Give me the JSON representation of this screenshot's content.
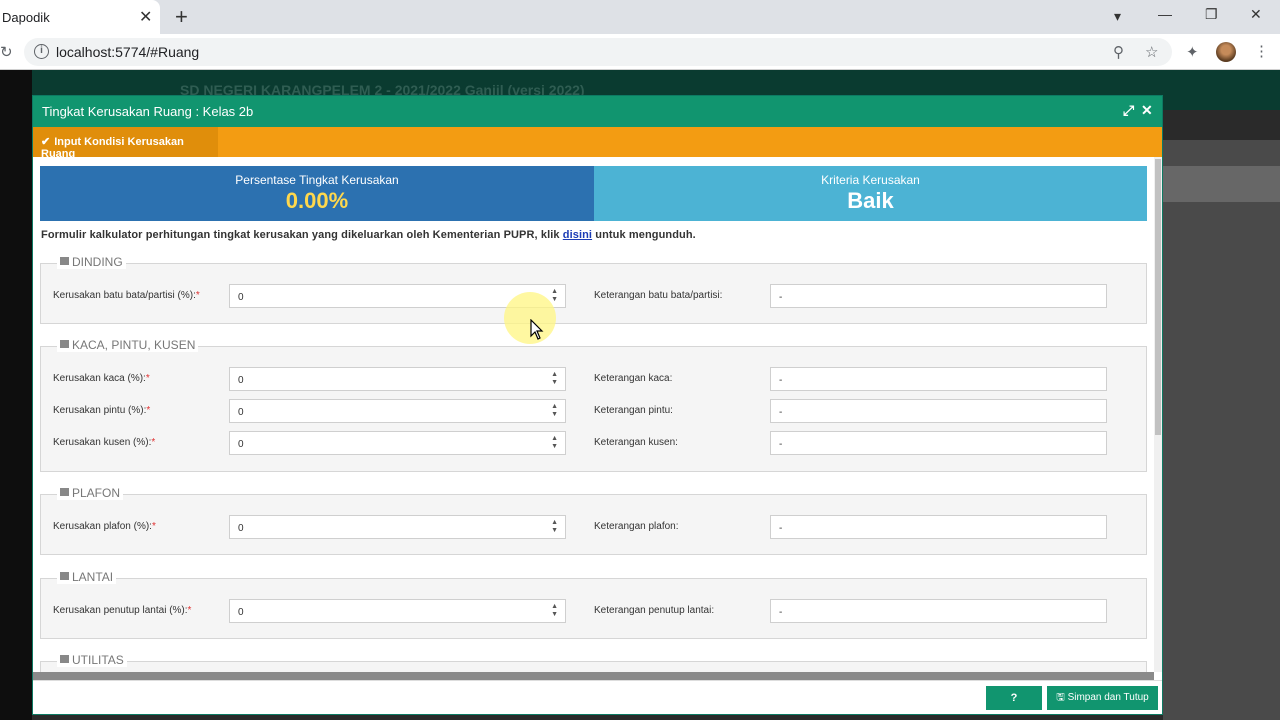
{
  "browser": {
    "tab_title": "Dapodik",
    "url": "localhost:5774/#Ruang"
  },
  "background_app": {
    "title": "SD NEGERI KARANGPELEM 2 - 2021/2022 Ganjil (versi 2022)"
  },
  "modal": {
    "title": "Tingkat Kerusakan Ruang : Kelas 2b",
    "tab_label": "Input Kondisi Kerusakan Ruang",
    "stats": {
      "left_label": "Persentase Tingkat Kerusakan",
      "left_value": "0.00%",
      "right_label": "Kriteria Kerusakan",
      "right_value": "Baik"
    },
    "formula": {
      "prefix": "Formulir kalkulator perhitungan tingkat kerusakan yang dikeluarkan oleh Kementerian PUPR, klik",
      "link": "disini",
      "suffix": "untuk mengunduh."
    },
    "sections": [
      {
        "legend": "DINDING",
        "rows": [
          {
            "label": "Kerusakan batu bata/partisi (%):",
            "value": "0",
            "note_label": "Keterangan batu bata/partisi:",
            "note_value": "-"
          }
        ]
      },
      {
        "legend": "KACA, PINTU, KUSEN",
        "rows": [
          {
            "label": "Kerusakan kaca (%):",
            "value": "0",
            "note_label": "Keterangan kaca:",
            "note_value": "-"
          },
          {
            "label": "Kerusakan pintu (%):",
            "value": "0",
            "note_label": "Keterangan pintu:",
            "note_value": "-"
          },
          {
            "label": "Kerusakan kusen (%):",
            "value": "0",
            "note_label": "Keterangan kusen:",
            "note_value": "-"
          }
        ]
      },
      {
        "legend": "PLAFON",
        "rows": [
          {
            "label": "Kerusakan plafon (%):",
            "value": "0",
            "note_label": "Keterangan plafon:",
            "note_value": "-"
          }
        ]
      },
      {
        "legend": "LANTAI",
        "rows": [
          {
            "label": "Kerusakan penutup lantai (%):",
            "value": "0",
            "note_label": "Keterangan penutup lantai:",
            "note_value": "-"
          }
        ]
      },
      {
        "legend": "UTILITAS",
        "rows": []
      }
    ],
    "required_mark": "*",
    "buttons": {
      "help": "?",
      "save": "Simpan dan Tutup"
    }
  },
  "colors": {
    "header_green": "#11956f",
    "orange": "#f39c12",
    "stat_blue": "#2c71b0",
    "stat_lightblue": "#4cb3d4"
  }
}
